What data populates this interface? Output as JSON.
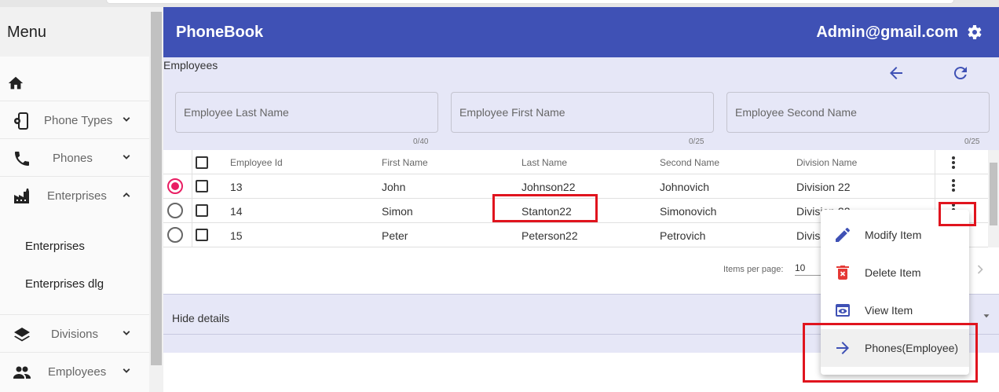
{
  "app": {
    "title": "PhoneBook",
    "user": "Admin@gmail.com"
  },
  "sidebar": {
    "title": "Menu",
    "items": [
      {
        "label": "Phone Types",
        "icon": "phone-settings-icon",
        "expanded": false
      },
      {
        "label": "Phones",
        "icon": "phone-icon",
        "expanded": false
      },
      {
        "label": "Enterprises",
        "icon": "factory-icon",
        "expanded": true
      },
      {
        "label": "Divisions",
        "icon": "layers-icon",
        "expanded": false
      },
      {
        "label": "Employees",
        "icon": "people-icon",
        "expanded": false
      }
    ],
    "subitems": [
      {
        "label": "Enterprises"
      },
      {
        "label": "Enterprises dlg"
      }
    ]
  },
  "panel": {
    "caption": "Employees",
    "filters": [
      {
        "placeholder": "Employee Last Name",
        "counter": "0/40"
      },
      {
        "placeholder": "Employee First Name",
        "counter": "0/25"
      },
      {
        "placeholder": "Employee Second Name",
        "counter": "0/25"
      }
    ]
  },
  "table": {
    "headers": [
      "Employee Id",
      "First Name",
      "Last Name",
      "Second Name",
      "Division Name"
    ],
    "rows": [
      {
        "id": "13",
        "first": "John",
        "last": "Johnson22",
        "second": "Johnovich",
        "division": "Division 22",
        "selected": true
      },
      {
        "id": "14",
        "first": "Simon",
        "last": "Stanton22",
        "second": "Simonovich",
        "division": "Division 22",
        "selected": false
      },
      {
        "id": "15",
        "first": "Peter",
        "last": "Peterson22",
        "second": "Petrovich",
        "division": "Division 22",
        "selected": false
      }
    ]
  },
  "paginator": {
    "items_per_page_label": "Items per page:",
    "page_size": "10"
  },
  "details": {
    "label": "Hide details"
  },
  "context_menu": {
    "items": [
      {
        "label": "Modify Item",
        "icon": "pencil-icon"
      },
      {
        "label": "Delete Item",
        "icon": "trash-icon"
      },
      {
        "label": "View Item",
        "icon": "eye-icon"
      },
      {
        "label": "Phones(Employee)",
        "icon": "arrow-right-icon"
      }
    ]
  },
  "colors": {
    "primary": "#3f51b5",
    "accent": "#e91e63",
    "panel": "#e6e7f7",
    "highlight": "#e0141e",
    "delete": "#e53935"
  }
}
